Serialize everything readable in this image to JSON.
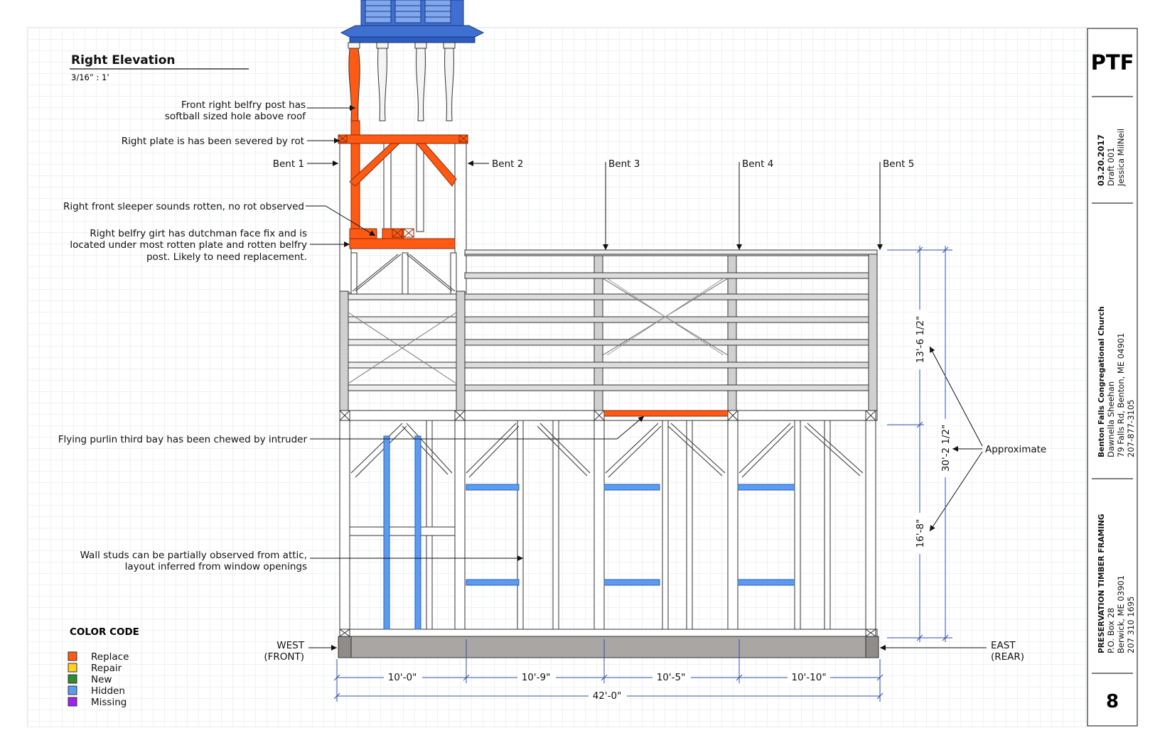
{
  "drawing": {
    "title": "Right Elevation",
    "scale": "3/16” : 1’"
  },
  "bents": [
    "Bent 1",
    "Bent 2",
    "Bent 3",
    "Bent 4",
    "Bent 5"
  ],
  "notes": {
    "belfry_post_1": "Front right belfry post has",
    "belfry_post_2": "softball sized hole above roof",
    "plate_severed": "Right plate is has been severed by rot",
    "sleeper": "Right front sleeper sounds rotten, no rot observed",
    "girt_1": "Right belfry girt has dutchman face fix and is",
    "girt_2": "located under most rotten plate and rotten belfry",
    "girt_3": "post. Likely to need replacement.",
    "purlin": "Flying purlin third bay has been chewed by intruder",
    "studs_1": "Wall studs can be partially observed from attic,",
    "studs_2": "layout inferred from window openings",
    "approximate": "Approximate"
  },
  "ends": {
    "west_1": "WEST",
    "west_2": "(FRONT)",
    "east_1": "EAST",
    "east_2": "(REAR)"
  },
  "dimensions": {
    "bays": [
      "10'-0\"",
      "10'-9\"",
      "10'-5\"",
      "10'-10\""
    ],
    "total": "42'-0\"",
    "roof_height": "13'-6 1/2\"",
    "wall_height": "16'-8\"",
    "overall_height": "30'-2 1/2\""
  },
  "legend": {
    "title": "COLOR CODE",
    "items": [
      {
        "label": "Replace",
        "color": "#ff5a14"
      },
      {
        "label": "Repair",
        "color": "#ffd21e"
      },
      {
        "label": "New",
        "color": "#2e8b2e"
      },
      {
        "label": "Hidden",
        "color": "#5b9cf0"
      },
      {
        "label": "Missing",
        "color": "#a020f0"
      }
    ]
  },
  "title_block": {
    "logo": "PTF",
    "date": "03.20.2017",
    "draft": "Draft 001",
    "author": "Jessica MilNeil",
    "project": "Benton Falls Congregational Church",
    "client": "Dawnella Sheehan",
    "address": "79 Falls Rd, Benton, ME 04901",
    "phone": "207-877-3105",
    "company": "PRESERVATION TIMBER FRAMING",
    "company_po": "P.O. Box 28",
    "company_city": "Berwick, ME 03901",
    "company_phone": "207 310 1695",
    "sheet_number": "8"
  },
  "colors": {
    "replace": "#ff5a14",
    "hidden": "#5b9cf0",
    "dim_line": "#2f4fb0",
    "timber_gray": "#d0d0d0",
    "sill": "#a9a6a3",
    "belfry_blue": "#3f6fd0"
  }
}
